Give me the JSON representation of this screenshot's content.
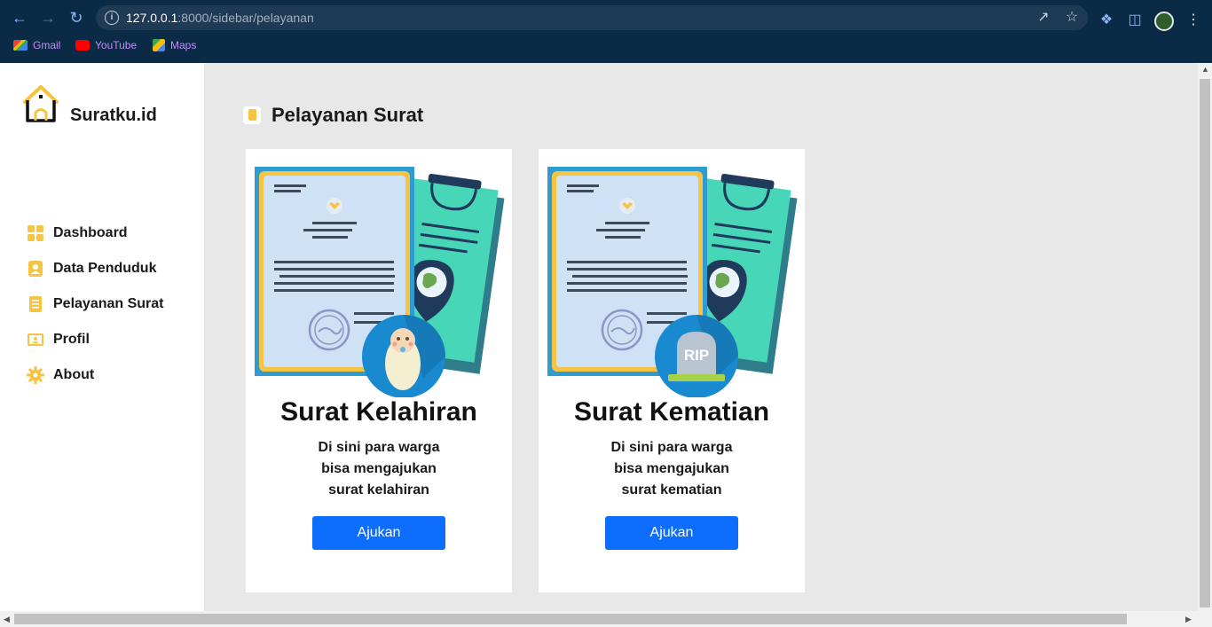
{
  "browser": {
    "url_host": "127.0.0.1",
    "url_path": ":8000/sidebar/pelayanan",
    "bookmarks": [
      {
        "label": "Gmail",
        "icon": "gmail-icon"
      },
      {
        "label": "YouTube",
        "icon": "youtube-icon"
      },
      {
        "label": "Maps",
        "icon": "maps-icon"
      }
    ]
  },
  "sidebar": {
    "brand": "Suratku.id",
    "items": [
      {
        "label": "Dashboard",
        "icon": "grid-icon"
      },
      {
        "label": "Data Penduduk",
        "icon": "person-doc-icon"
      },
      {
        "label": "Pelayanan Surat",
        "icon": "document-icon"
      },
      {
        "label": "Profil",
        "icon": "profile-card-icon"
      },
      {
        "label": "About",
        "icon": "gear-icon"
      }
    ]
  },
  "main": {
    "title": "Pelayanan Surat",
    "cards": [
      {
        "title": "Surat Kelahiran",
        "desc": [
          "Di sini para warga",
          "bisa mengajukan",
          "surat kelahiran"
        ],
        "button": "Ajukan",
        "badge_icon": "baby-icon"
      },
      {
        "title": "Surat Kematian",
        "desc": [
          "Di sini para warga",
          "bisa mengajukan",
          "surat kematian"
        ],
        "button": "Ajukan",
        "badge_icon": "tombstone-icon",
        "badge_text": "RIP"
      }
    ]
  },
  "colors": {
    "accent": "#0d6efd",
    "yellow": "#f6c443",
    "chrome": "#0b2a45"
  }
}
